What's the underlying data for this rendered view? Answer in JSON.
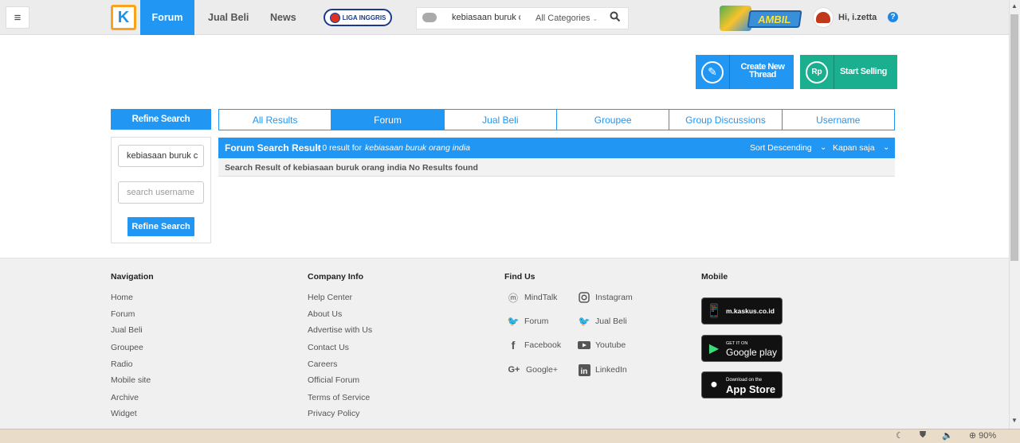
{
  "header": {
    "nav": {
      "forum": "Forum",
      "jual_beli": "Jual Beli",
      "news": "News"
    },
    "liga_badge": "LIGA INGGRIS",
    "search": {
      "query": "kebiasaan buruk c",
      "category": "All Categories"
    },
    "promo": "AMBIL",
    "user_greeting": "Hi, i.zetta",
    "help": "?"
  },
  "actions": {
    "create_thread": "Create New Thread",
    "start_selling": "Start Selling",
    "rp_icon": "Rp"
  },
  "refine": {
    "title": "Refine Search",
    "keyword_value": "kebiasaan buruk c",
    "username_placeholder": "search username",
    "button": "Refine Search"
  },
  "tabs": [
    "All Results",
    "Forum",
    "Jual Beli",
    "Groupee",
    "Group Discussions",
    "Username"
  ],
  "active_tab": "Forum",
  "results": {
    "title": "Forum Search Result",
    "count_text": "- 0 result for",
    "query": "kebiasaan buruk orang india",
    "sort": "Sort Descending",
    "time_filter": "Kapan saja",
    "message": "Search Result of kebiasaan buruk orang india No Results found"
  },
  "footer": {
    "navigation": {
      "title": "Navigation",
      "links": [
        "Home",
        "Forum",
        "Jual Beli",
        "Groupee",
        "Radio",
        "Mobile site",
        "Archive",
        "Widget"
      ]
    },
    "company": {
      "title": "Company Info",
      "links": [
        "Help Center",
        "About Us",
        "Advertise with Us",
        "Contact Us",
        "Careers",
        "Official Forum",
        "Terms of Service",
        "Privacy Policy"
      ]
    },
    "find_us": {
      "title": "Find Us",
      "left": [
        "MindTalk",
        "Forum",
        "Facebook",
        "Google+"
      ],
      "right": [
        "Instagram",
        "Jual Beli",
        "Youtube",
        "LinkedIn"
      ]
    },
    "mobile": {
      "title": "Mobile",
      "badges": [
        "m.kaskus.co.id",
        "Google play",
        "App Store"
      ],
      "badge_small": [
        "",
        "GET IT ON",
        "Download on the"
      ]
    }
  },
  "statusbar": {
    "zoom": "90%"
  },
  "colors": {
    "primary": "#2196f3",
    "sell": "#1aaf8e",
    "logo_border": "#f9a21b"
  }
}
